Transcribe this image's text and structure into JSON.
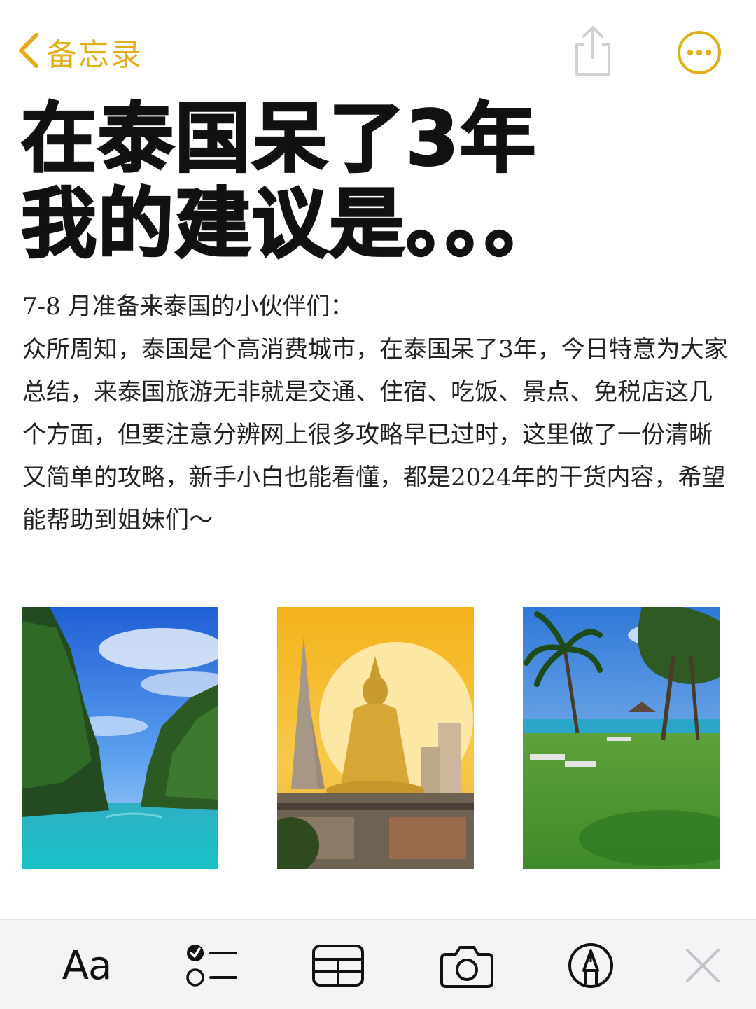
{
  "nav": {
    "back_label": "备忘录",
    "back_icon": "chevron-left-icon",
    "share_icon": "share-icon",
    "more_icon": "ellipsis-circle-icon",
    "accent_color": "#e2ad17"
  },
  "note": {
    "title_lines": [
      "在泰国呆了3年",
      "我的建议是。。。"
    ],
    "paragraphs": [
      "7-8 月准备来泰国的小伙伴们：",
      "众所周知，泰国是个高消费城市，在泰国呆了3年，今日特意为大家总结，来泰国旅游无非就是交通、住宿、吃饭、景点、免税店这几个方面，但要注意分辨网上很多攻略早已过时，这里做了一份清晰又简单的攻略，新手小白也能看懂，都是2024年的干货内容，希望能帮助到姐妹们～"
    ]
  },
  "photos": [
    {
      "name": "limestone-cliffs-sea-photo"
    },
    {
      "name": "golden-buddy-temple-sunset-photo"
    },
    {
      "name": "beach-resort-lawn-palms-photo"
    }
  ],
  "toolbar": {
    "format_label": "Aa",
    "checklist_icon": "checklist-icon",
    "table_icon": "table-icon",
    "camera_icon": "camera-icon",
    "markup_icon": "pen-circle-icon",
    "close_icon": "close-icon"
  }
}
